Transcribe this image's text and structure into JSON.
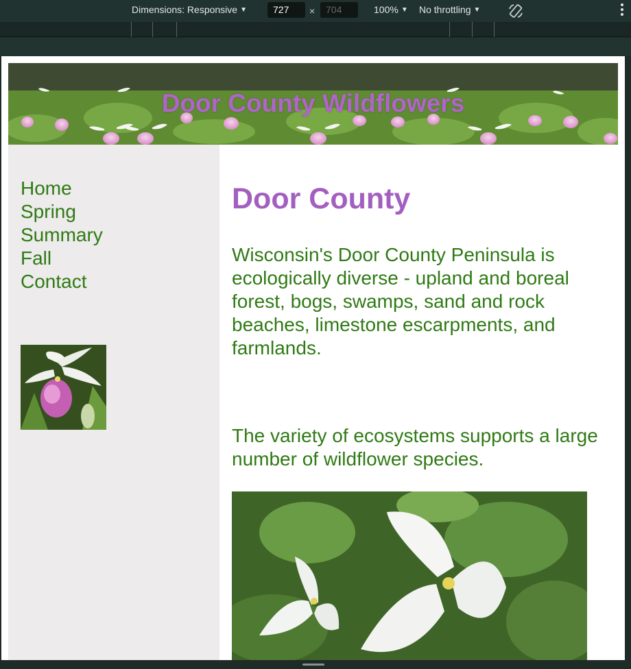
{
  "devtools": {
    "dimensions_label": "Dimensions: Responsive",
    "width": "727",
    "height": "704",
    "times": "×",
    "zoom": "100%",
    "throttling": "No throttling"
  },
  "site": {
    "banner_title": "Door County Wildflowers",
    "nav": [
      "Home",
      "Spring",
      "Summary",
      "Fall",
      "Contact"
    ],
    "heading": "Door County",
    "paragraph1": "Wisconsin's Door County Peninsula is ecologically diverse - upland and boreal forest, bogs, swamps, sand and rock beaches, limestone escarpments, and farmlands.",
    "paragraph2": "The variety of ecosystems supports a large number of wildflower species."
  },
  "icons": {
    "dropdown": "caret-down-icon",
    "rotate": "rotate-icon",
    "more": "more-vertical-icon"
  },
  "colors": {
    "nav_text": "#2f7a14",
    "heading": "#a35fc0",
    "banner_title": "#b065c8",
    "sidebar_bg": "#edebeb"
  }
}
